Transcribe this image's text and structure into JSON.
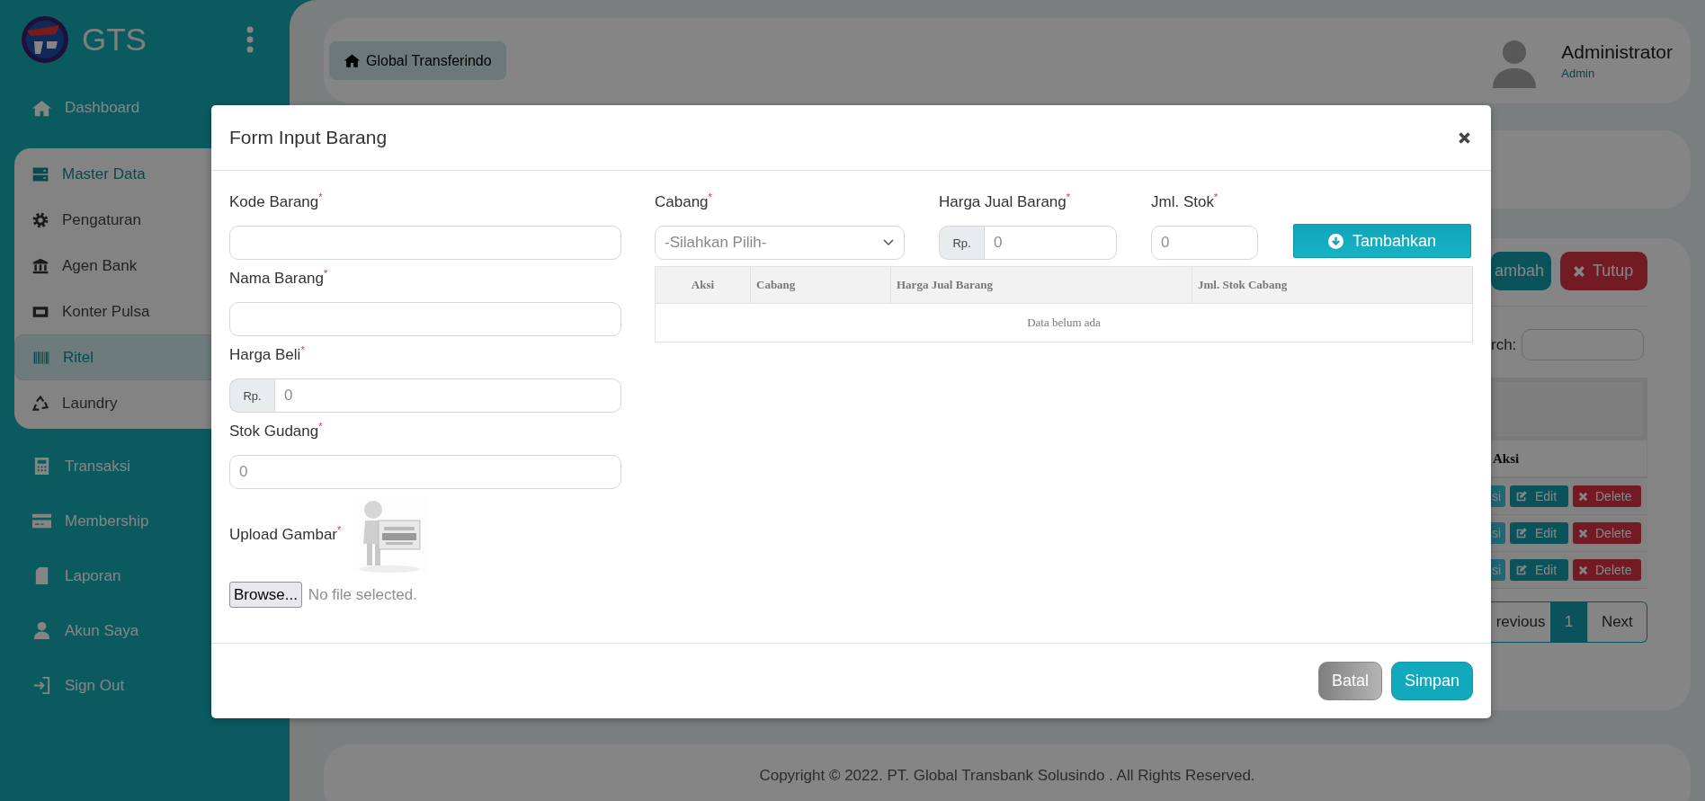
{
  "sidebar": {
    "brand": "GTS",
    "items": [
      {
        "label": "Dashboard",
        "selected": false
      },
      {
        "label": "Master Data",
        "selected": false,
        "expanded": true,
        "children": [
          {
            "label": "Pengaturan",
            "selected": false
          },
          {
            "label": "Agen Bank",
            "selected": false
          },
          {
            "label": "Konter Pulsa",
            "selected": false
          },
          {
            "label": "Ritel",
            "selected": true
          },
          {
            "label": "Laundry",
            "selected": false
          }
        ]
      },
      {
        "label": "Transaksi",
        "selected": false
      },
      {
        "label": "Membership",
        "selected": false
      },
      {
        "label": "Laporan",
        "selected": false
      },
      {
        "label": "Akun Saya",
        "selected": false
      },
      {
        "label": "Sign Out",
        "selected": false
      }
    ]
  },
  "header": {
    "breadcrumb": "Global Transferindo",
    "user_name": "Administrator",
    "user_role": "Admin"
  },
  "page_card": {
    "buttons": [
      {
        "label": "ambah",
        "kind": "primary"
      },
      {
        "label": "Tutup",
        "kind": "danger"
      }
    ],
    "search_label": "rch:",
    "table": {
      "columns": [
        "Aksi"
      ],
      "rows": [
        {
          "actions": [
            {
              "label": "si",
              "kind": "info"
            },
            {
              "label": "Edit",
              "kind": "edit"
            },
            {
              "label": "Delete",
              "kind": "delete"
            }
          ]
        },
        {
          "actions": [
            {
              "label": "si",
              "kind": "info"
            },
            {
              "label": "Edit",
              "kind": "edit"
            },
            {
              "label": "Delete",
              "kind": "delete"
            }
          ]
        },
        {
          "actions": [
            {
              "label": "si",
              "kind": "info"
            },
            {
              "label": "Edit",
              "kind": "edit"
            },
            {
              "label": "Delete",
              "kind": "delete"
            }
          ]
        }
      ]
    },
    "pagination": [
      {
        "label": "revious",
        "selected": false
      },
      {
        "label": "1",
        "selected": true
      },
      {
        "label": "Next",
        "selected": false
      }
    ]
  },
  "footer": "Copyright © 2022. PT. Global Transbank Solusindo . All Rights Reserved.",
  "modal": {
    "title": "Form Input Barang",
    "left_fields": [
      {
        "label": "Kode Barang$^{*}$",
        "kind": "text"
      },
      {
        "label": "Nama Barang$^{*}$",
        "kind": "text"
      },
      {
        "label": "Harga Beli$^{*}$",
        "kind": "currency",
        "prefix": "Rp.",
        "placeholder": "0"
      },
      {
        "label": "Stok Gudang$^{*}$",
        "kind": "text",
        "placeholder": "0"
      }
    ],
    "upload": {
      "label": "Upload Gambar$^{*}$",
      "button": "Browse...",
      "status": "No file selected."
    },
    "right_fields": [
      {
        "label": "Cabang$^{*}$",
        "kind": "select",
        "value": "-Silahkan Pilih-"
      },
      {
        "label": "Harga Jual Barang$^{*}$",
        "kind": "currency",
        "prefix": "Rp.",
        "placeholder": "0"
      },
      {
        "label": "Jml. Stok$^{*}$",
        "kind": "text",
        "placeholder": "0"
      }
    ],
    "add_button": "Tambahkan",
    "table": {
      "columns": [
        "Aksi",
        "Cabang",
        "Harga Jual Barang",
        "Jml. Stok Cabang"
      ],
      "empty_text": "Data belum ada"
    },
    "buttons": [
      {
        "label": "Batal",
        "kind": "secondary"
      },
      {
        "label": "Simpan",
        "kind": "primary"
      }
    ]
  }
}
